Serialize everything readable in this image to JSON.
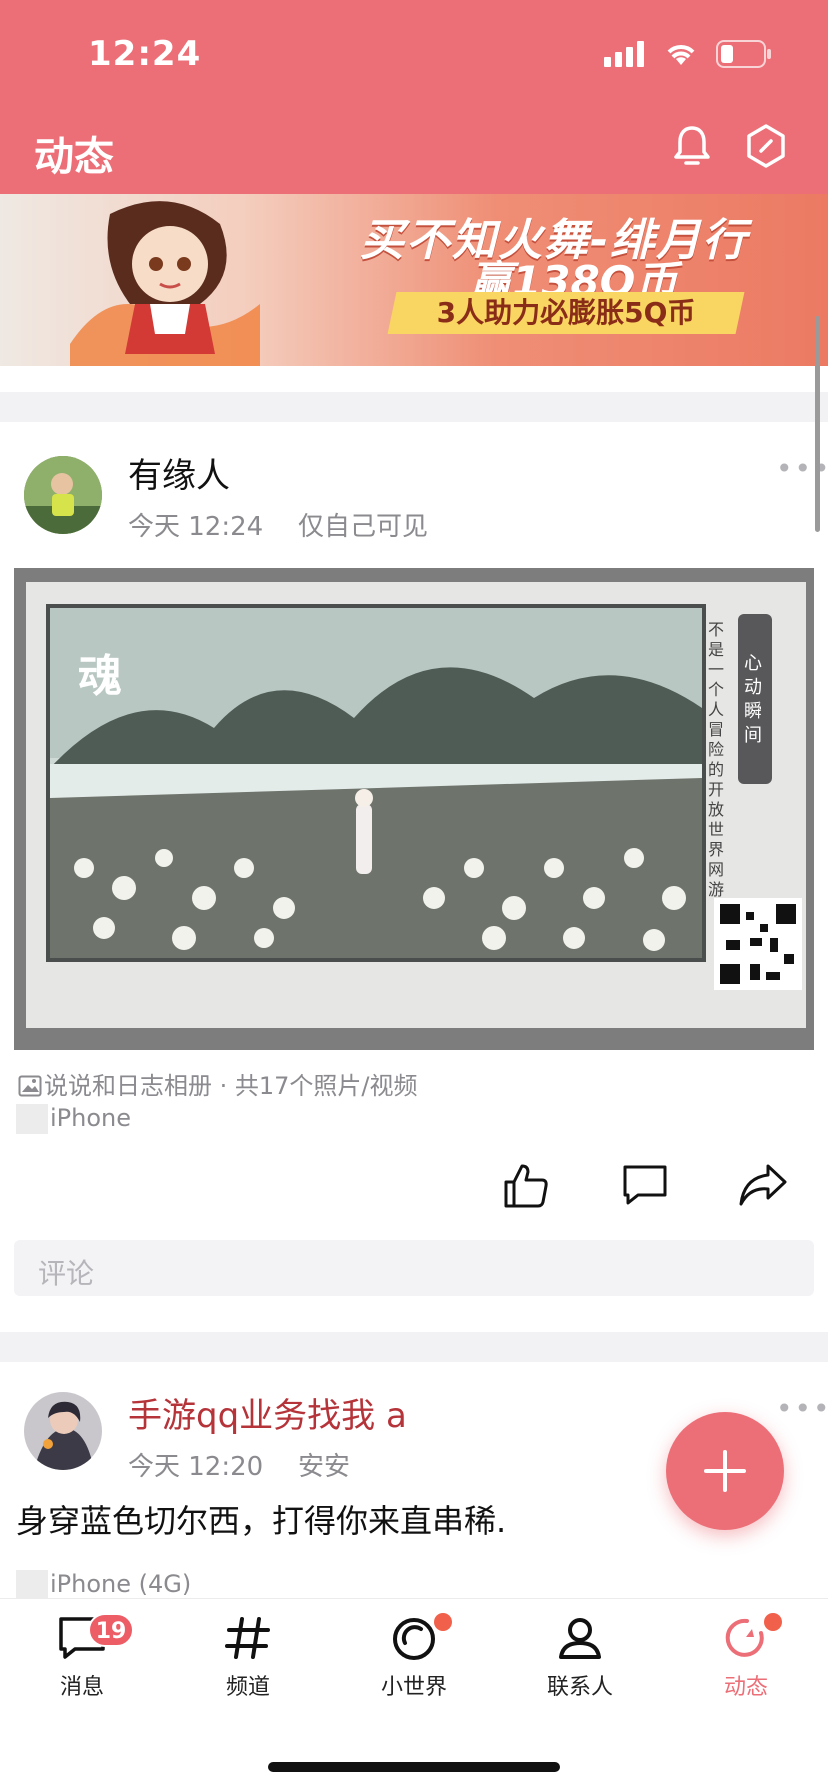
{
  "status_bar": {
    "time": "12:24"
  },
  "header": {
    "title": "动态"
  },
  "banner": {
    "line1": "买不知火舞-绯月行",
    "line2": "赢138Q币",
    "line3": "3人助力必膨胀5Q币"
  },
  "posts": [
    {
      "author": "有缘人",
      "time": "今天 12:24",
      "visibility": "仅自己可见",
      "photo": {
        "vertical_text": "不是一个人冒险的开放世界网游",
        "badge_text": "心动瞬间",
        "logo_text": "魂"
      },
      "album_source": "说说和日志相册 · 共17个照片/视频",
      "device": "iPhone",
      "comment_placeholder": "评论"
    },
    {
      "author": "手游qq业务找我 a",
      "time": "今天 12:20",
      "location": "安安",
      "text": "身穿蓝色切尔西，打得你来直串稀.",
      "device": "iPhone (4G)"
    }
  ],
  "tabs": [
    {
      "label": "消息",
      "icon": "message-icon",
      "badge": "19"
    },
    {
      "label": "频道",
      "icon": "hashtag-icon"
    },
    {
      "label": "小世界",
      "icon": "world-icon"
    },
    {
      "label": "联系人",
      "icon": "contacts-icon"
    },
    {
      "label": "动态",
      "icon": "feed-icon",
      "active": true
    }
  ],
  "colors": {
    "brand": "#ec6f78",
    "badge": "#ec5d66",
    "author_highlight": "#b5343a"
  }
}
